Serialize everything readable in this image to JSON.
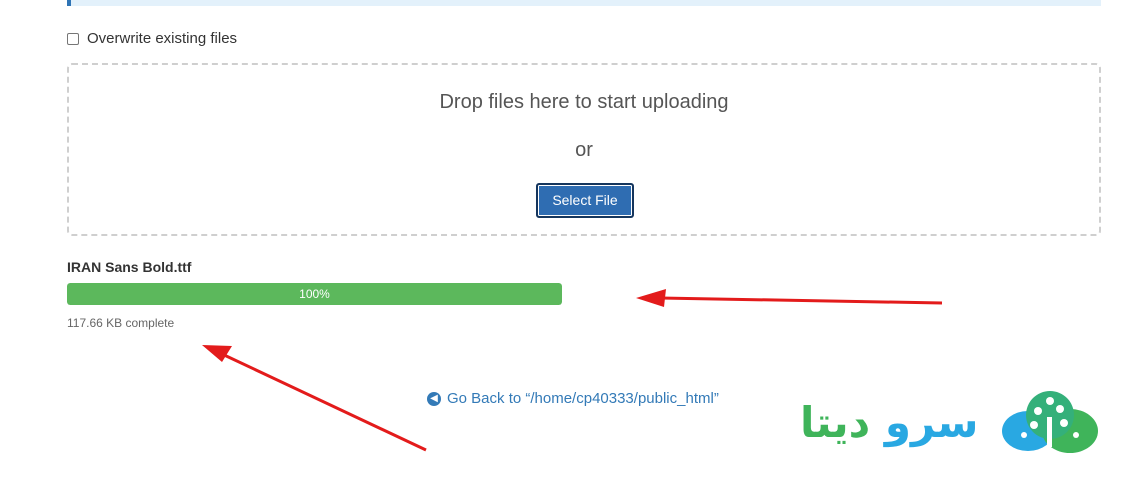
{
  "upload": {
    "overwrite_label": "Overwrite existing files",
    "overwrite_checked": false,
    "drop_title": "Drop files here to start uploading",
    "or_text": "or",
    "select_button": "Select File"
  },
  "file": {
    "name": "IRAN Sans Bold.ttf",
    "progress_label": "100%",
    "progress": 1.0,
    "status": "117.66 KB complete"
  },
  "navigation": {
    "go_back": "Go Back to “/home/cp40333/public_html”",
    "go_back_icon": "arrow-left-circle-icon"
  },
  "branding": {
    "name_part1": "سرو",
    "name_part2": "دیتا",
    "logo": "cloud-tree-logo"
  },
  "colors": {
    "progress": "#5cb85c",
    "button": "#2f6db2",
    "link": "#337ab7",
    "arrow": "#e31b1b",
    "brand_blue": "#29a8e2",
    "brand_green": "#3fb45a"
  }
}
